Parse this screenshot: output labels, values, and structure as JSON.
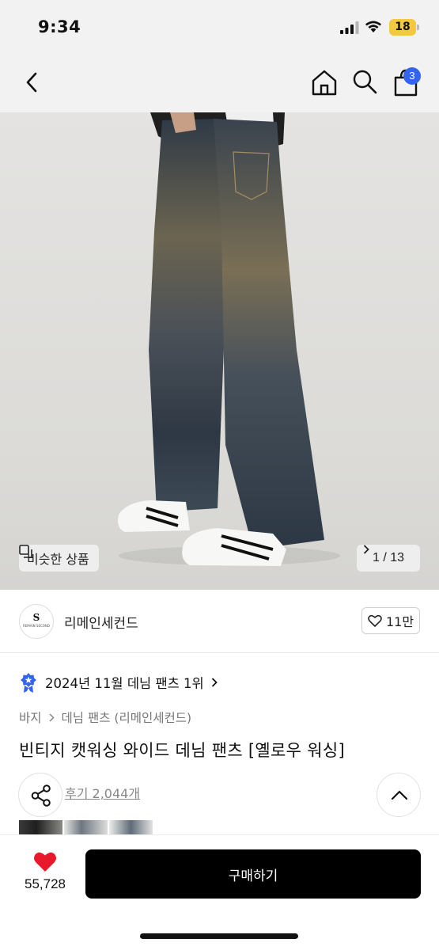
{
  "status_bar": {
    "time": "9:34",
    "battery": "18"
  },
  "nav": {
    "cart_count": "3",
    "icons": [
      "back-chevron-icon",
      "home-icon",
      "search-icon",
      "cart-icon"
    ]
  },
  "hero": {
    "similar_label": "비슷한 상품",
    "image_counter": "1 / 13"
  },
  "shop": {
    "name": "리메인세컨드",
    "logo_text": "S",
    "logo_subtext": "REMAIN SECOND",
    "likes": "11만"
  },
  "product": {
    "ranking": "2024년 11월 데님 팬츠 1위",
    "breadcrumb": [
      "바지",
      "데님 팬츠 (리메인세컨드)"
    ],
    "title": "빈티지 캣워싱 와이드 데님 팬츠 [옐로우 워싱]",
    "reviews": "후기 2,044개"
  },
  "bottom_bar": {
    "wish_count": "55,728",
    "buy_label": "구매하기"
  },
  "colors": {
    "accent_blue": "#3264f0",
    "heart_red": "#e8192c",
    "buy_button": "#000000"
  }
}
